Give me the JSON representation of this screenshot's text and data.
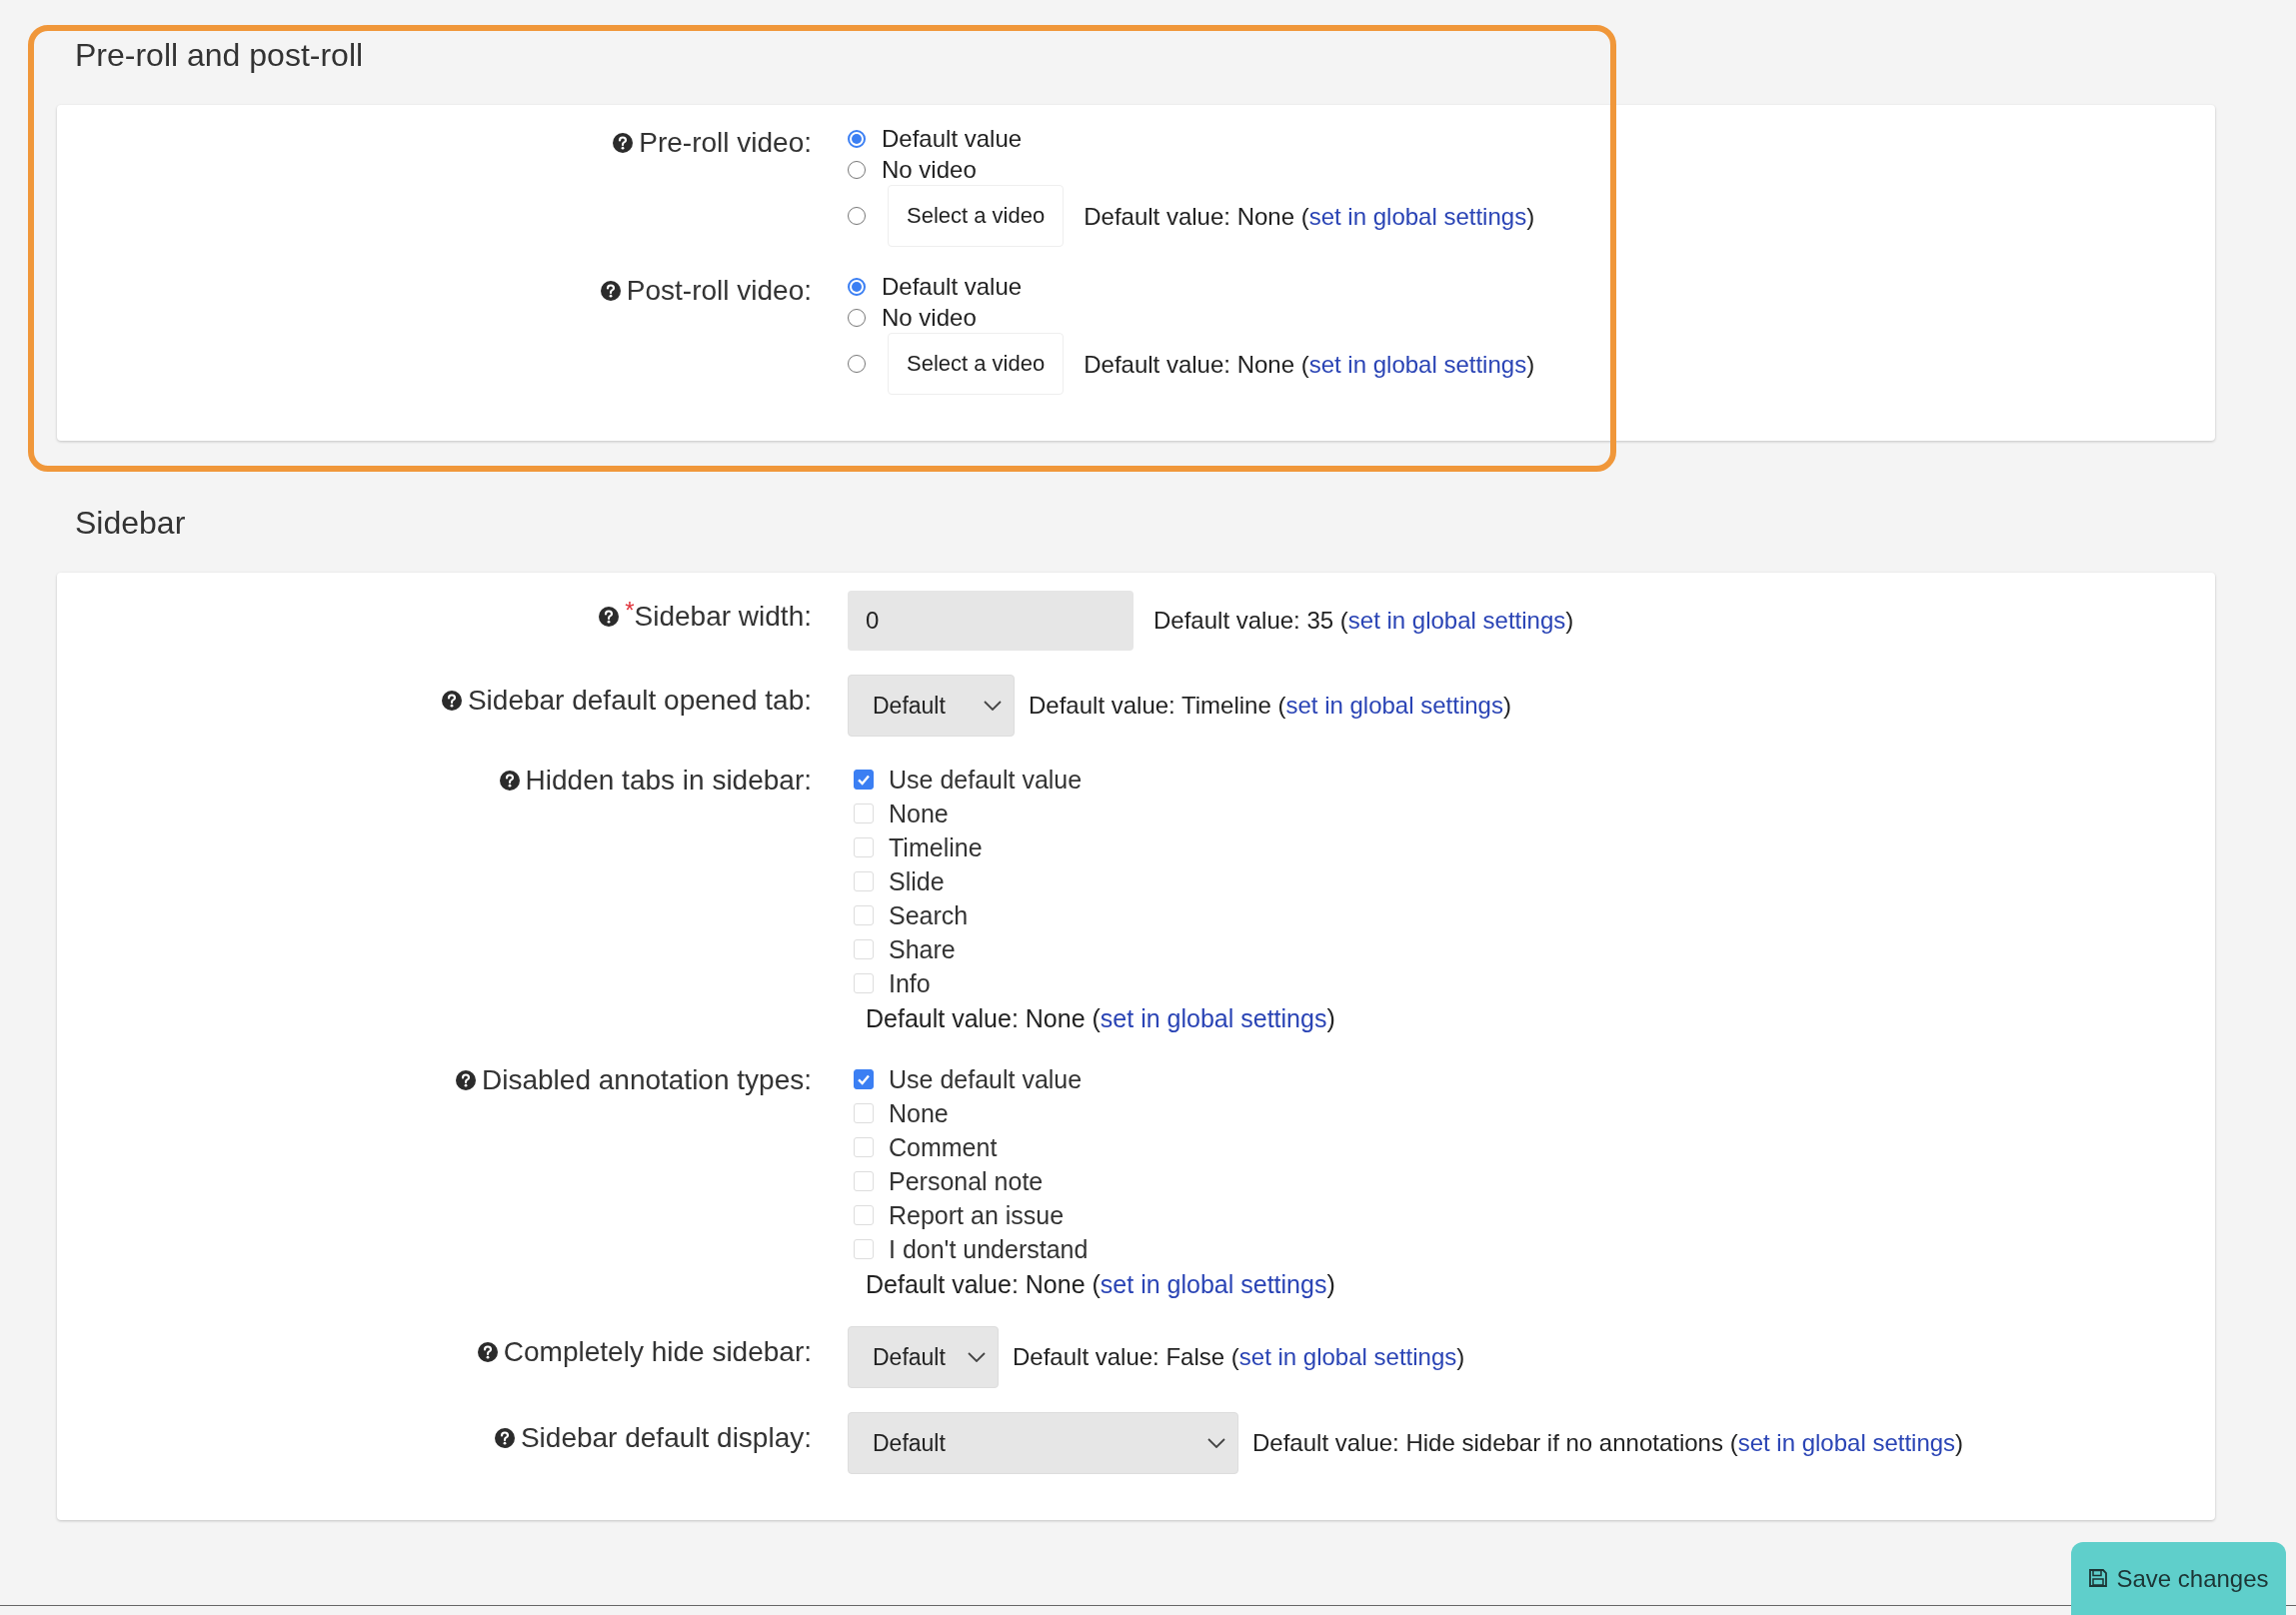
{
  "sections": [
    {
      "title": "Pre-roll and post-roll",
      "highlighted": true,
      "fields": [
        {
          "kind": "radio_group",
          "label": "Pre-roll video:",
          "options": [
            {
              "label": "Default value",
              "selected": true
            },
            {
              "label": "No video",
              "selected": false
            },
            {
              "button": "Select a video",
              "selected": false
            }
          ],
          "note": {
            "prefix": "Default value: None (",
            "link": "set in global settings",
            "suffix": ")"
          }
        },
        {
          "kind": "radio_group",
          "label": "Post-roll video:",
          "options": [
            {
              "label": "Default value",
              "selected": true
            },
            {
              "label": "No video",
              "selected": false
            },
            {
              "button": "Select a video",
              "selected": false
            }
          ],
          "note": {
            "prefix": "Default value: None (",
            "link": "set in global settings",
            "suffix": ")"
          }
        }
      ]
    },
    {
      "title": "Sidebar",
      "highlighted": false,
      "fields": [
        {
          "kind": "text_input",
          "label": "Sidebar width:",
          "required_mark": "*",
          "value": "0",
          "note": {
            "prefix": "Default value: 35 (",
            "link": "set in global settings",
            "suffix": ")"
          }
        },
        {
          "kind": "select",
          "label": "Sidebar default opened tab:",
          "value": "Default",
          "note": {
            "prefix": "Default value: Timeline (",
            "link": "set in global settings",
            "suffix": ")"
          }
        },
        {
          "kind": "checkbox_group",
          "label": "Hidden tabs in sidebar:",
          "options": [
            {
              "label": "Use default value",
              "checked": true
            },
            {
              "label": "None",
              "checked": false
            },
            {
              "label": "Timeline",
              "checked": false
            },
            {
              "label": "Slide",
              "checked": false
            },
            {
              "label": "Search",
              "checked": false
            },
            {
              "label": "Share",
              "checked": false
            },
            {
              "label": "Info",
              "checked": false
            }
          ],
          "note": {
            "prefix": "Default value: None (",
            "link": "set in global settings",
            "suffix": ")"
          }
        },
        {
          "kind": "checkbox_group",
          "label": "Disabled annotation types:",
          "options": [
            {
              "label": "Use default value",
              "checked": true
            },
            {
              "label": "None",
              "checked": false
            },
            {
              "label": "Comment",
              "checked": false
            },
            {
              "label": "Personal note",
              "checked": false
            },
            {
              "label": "Report an issue",
              "checked": false
            },
            {
              "label": "I don't understand",
              "checked": false
            }
          ],
          "note": {
            "prefix": "Default value: None (",
            "link": "set in global settings",
            "suffix": ")"
          }
        },
        {
          "kind": "select",
          "label": "Completely hide sidebar:",
          "value": "Default",
          "note": {
            "prefix": "Default value: False (",
            "link": "set in global settings",
            "suffix": ")"
          }
        },
        {
          "kind": "select",
          "label": "Sidebar default display:",
          "value": "Default",
          "note": {
            "prefix": "Default value: Hide sidebar if no annotations (",
            "link": "set in global settings",
            "suffix": ")"
          }
        }
      ]
    }
  ],
  "save_button": "Save changes"
}
